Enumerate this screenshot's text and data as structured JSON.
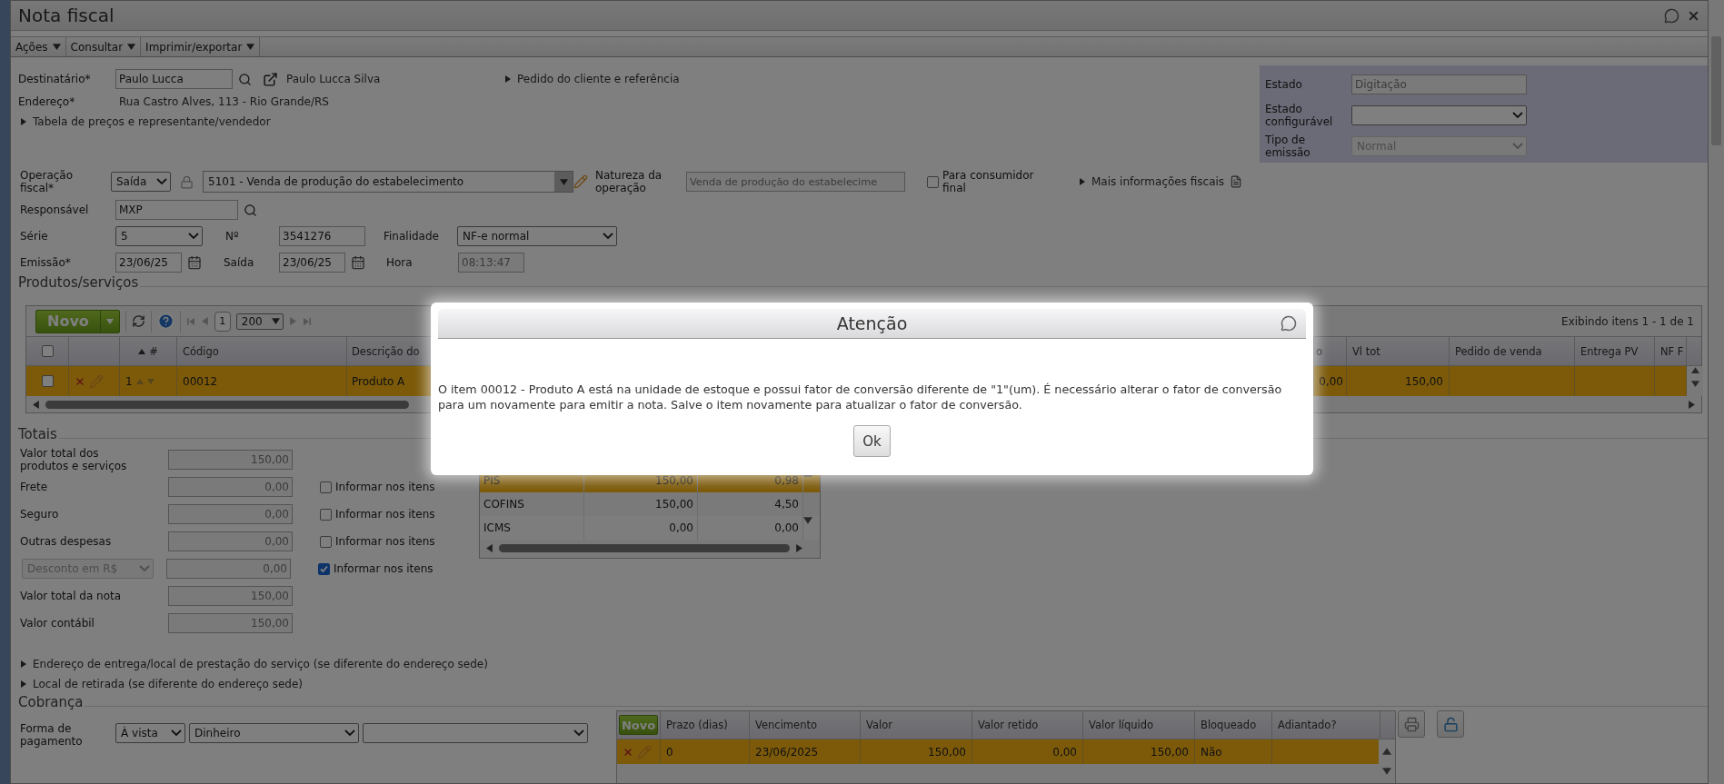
{
  "window": {
    "title": "Nota fiscal"
  },
  "menu": [
    {
      "label": "Ações"
    },
    {
      "label": "Consultar"
    },
    {
      "label": "Imprimir/exportar"
    }
  ],
  "recipient": {
    "label": "Destinatário*",
    "value": "Paulo Lucca",
    "name": "Paulo Lucca Silva",
    "address_label": "Endereço*",
    "address": "Rua Castro Alves, 113 - Rio Grande/RS"
  },
  "order_link": {
    "label": "Pedido do cliente e referência",
    "expanded": false
  },
  "price_link": {
    "label": "Tabela de preços e representante/vendedor",
    "expanded": false
  },
  "status_panel": [
    {
      "label": "Estado",
      "value": "Digitação",
      "kind": "text",
      "disabled": true
    },
    {
      "label": "Estado configurável",
      "kind": "select",
      "disabled": false
    },
    {
      "label": "Tipo de emissão",
      "value": "Normal",
      "kind": "select",
      "disabled": true
    }
  ],
  "fiscal": {
    "operation_label": "Operação fiscal*",
    "operation_type": "Saída",
    "cfop": "5101 - Venda de produção do estabelecimento",
    "nature_label": "Natureza da operação",
    "nature_value": "Venda de produção do estabelecime",
    "consumer": {
      "label": "Para consumidor final",
      "checked": false
    },
    "more_info": {
      "label": "Mais informações fiscais",
      "expanded": false
    },
    "responsible_label": "Responsável",
    "responsible_value": "MXP",
    "series_label": "Série",
    "series_value": "5",
    "number_label": "Nº",
    "number_value": "3541276",
    "purpose_label": "Finalidade",
    "purpose_value": "NF-e normal",
    "issue_label": "Emissão*",
    "issue_value": "23/06/25",
    "exit_label": "Saída",
    "exit_value": "23/06/25",
    "time_label": "Hora",
    "time_value": "08:13:47"
  },
  "products": {
    "title": "Produtos/serviços",
    "new_button": "Novo",
    "page": "1",
    "page_size": "200",
    "summary": "Exibindo itens 1 - 1 de 1",
    "select_all": {
      "checked": false
    },
    "columns": [
      {
        "label": "#",
        "sorted": true
      },
      {
        "label": "Código",
        "sorted": false
      },
      {
        "label": "Descrição do",
        "sorted": false
      },
      {
        "label": "o",
        "sorted": false
      },
      {
        "label": "Vl tot",
        "sorted": false
      },
      {
        "label": "Pedido de venda",
        "sorted": false
      },
      {
        "label": "Entrega PV",
        "sorted": false
      },
      {
        "label": "NF F",
        "sorted": false
      }
    ],
    "rows": [
      {
        "selected": true,
        "checked": false,
        "cells": [
          "1",
          "00012",
          "Produto A",
          "0,00",
          "150,00"
        ]
      }
    ]
  },
  "totals": {
    "title": "Totais",
    "rows": [
      {
        "kind": "field",
        "label": "Valor total dos produtos e serviços",
        "value": "150,00"
      },
      {
        "kind": "field",
        "label": "Frete",
        "value": "0,00",
        "itemize": {
          "label": "Informar nos itens",
          "checked": false
        }
      },
      {
        "kind": "field",
        "label": "Seguro",
        "value": "0,00",
        "itemize": {
          "label": "Informar nos itens",
          "checked": false
        }
      },
      {
        "kind": "field",
        "label": "Outras despesas",
        "value": "0,00",
        "itemize": {
          "label": "Informar nos itens",
          "checked": false
        }
      },
      {
        "kind": "select",
        "label": "Desconto em R$",
        "value": "0,00",
        "itemize": {
          "label": "Informar nos itens",
          "checked": true
        }
      },
      {
        "kind": "field",
        "label": "Valor total da nota",
        "value": "150,00"
      },
      {
        "kind": "field",
        "label": "Valor contábil",
        "value": "150,00"
      }
    ],
    "taxes": [
      {
        "name": "PIS",
        "base": "150,00",
        "amount": "0,98",
        "selected": true
      },
      {
        "name": "COFINS",
        "base": "150,00",
        "amount": "4,50",
        "selected": false
      },
      {
        "name": "ICMS",
        "base": "0,00",
        "amount": "0,00",
        "selected": false
      }
    ]
  },
  "extra_links": [
    {
      "label": "Endereço de entrega/local de prestação do serviço (se diferente do endereço sede)",
      "expanded": false
    },
    {
      "label": "Local de retirada (se diferente do endereço sede)",
      "expanded": false
    }
  ],
  "billing": {
    "title": "Cobrança",
    "payment_label": "Forma de pagamento",
    "payment_term": "À vista",
    "payment_method": "Dinheiro",
    "new_button": "Novo",
    "columns": [
      "Prazo (dias)",
      "Vencimento",
      "Valor",
      "Valor retido",
      "Valor líquido",
      "Bloqueado",
      "Adiantado?"
    ],
    "rows": [
      {
        "selected": true,
        "cells": [
          "0",
          "23/06/2025",
          "150,00",
          "0,00",
          "150,00",
          "Não"
        ]
      }
    ]
  },
  "modal": {
    "title": "Atenção",
    "message": "O item 00012 - Produto A está na unidade de estoque e possui fator de conversão diferente de \"1\"(um). É necessário alterar o fator de conversão para um novamente para emitir a nota. Salve o item novamente para atualizar o fator de conversão.",
    "button": "Ok"
  }
}
